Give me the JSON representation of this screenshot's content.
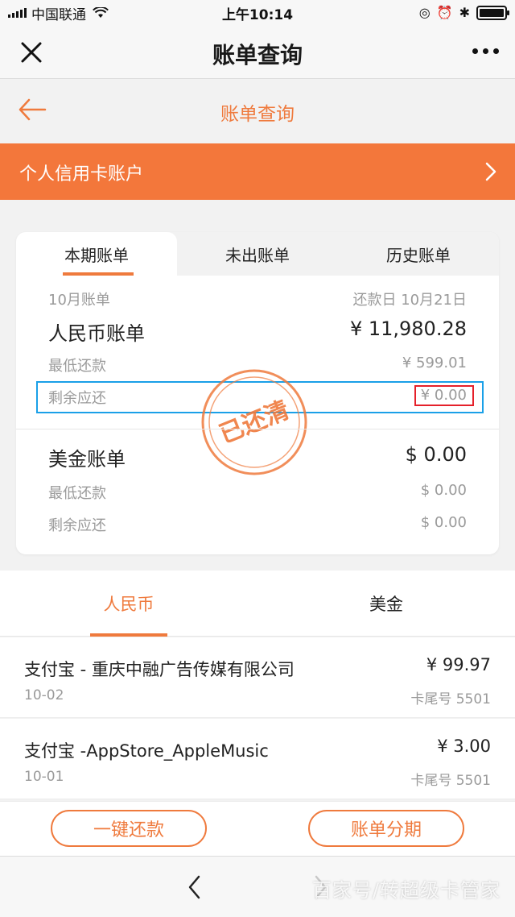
{
  "status_bar": {
    "carrier": "中国联通",
    "time": "上午10:14",
    "battery_level": 1.0
  },
  "title_bar": {
    "title": "账单查询",
    "icons": [
      "close-icon",
      "more-icon"
    ]
  },
  "page_header": {
    "title": "账单查询",
    "back_icon": "back-arrow-icon"
  },
  "account_banner": {
    "label": "个人信用卡账户"
  },
  "bill_tabs": {
    "current": "本期账单",
    "unbilled": "未出账单",
    "history": "历史账单"
  },
  "rmb_bill": {
    "month": "10月账单",
    "due_date": "还款日 10月21日",
    "title": "人民币账单",
    "total": "¥ 11,980.28",
    "min_payment_label": "最低还款",
    "min_payment": "¥ 599.01",
    "remaining_label": "剩余应还",
    "remaining": "¥ 0.00"
  },
  "stamp": {
    "text": "已还清"
  },
  "usd_bill": {
    "title": "美金账单",
    "total": "$ 0.00",
    "min_payment_label": "最低还款",
    "min_payment": "$ 0.00",
    "remaining_label": "剩余应还",
    "remaining": "$ 0.00"
  },
  "currency_tabs": {
    "cny": "人民币",
    "usd": "美金"
  },
  "transactions": [
    {
      "merchant": "支付宝 - 重庆中融广告传媒有限公司",
      "amount": "¥ 99.97",
      "date": "10-02",
      "card": "卡尾号 5501"
    },
    {
      "merchant": "支付宝 -AppStore_AppleMusic",
      "amount": "¥ 3.00",
      "date": "10-01",
      "card": "卡尾号 5501"
    }
  ],
  "actions": {
    "pay": "一键还款",
    "installment": "账单分期"
  },
  "nav": {
    "watermark": "百家号/转超级卡管家"
  },
  "colors": {
    "accent": "#ef7a3d",
    "banner": "#f3773b",
    "highlight_blue": "#1aa0e8",
    "highlight_red": "#e5202a"
  }
}
